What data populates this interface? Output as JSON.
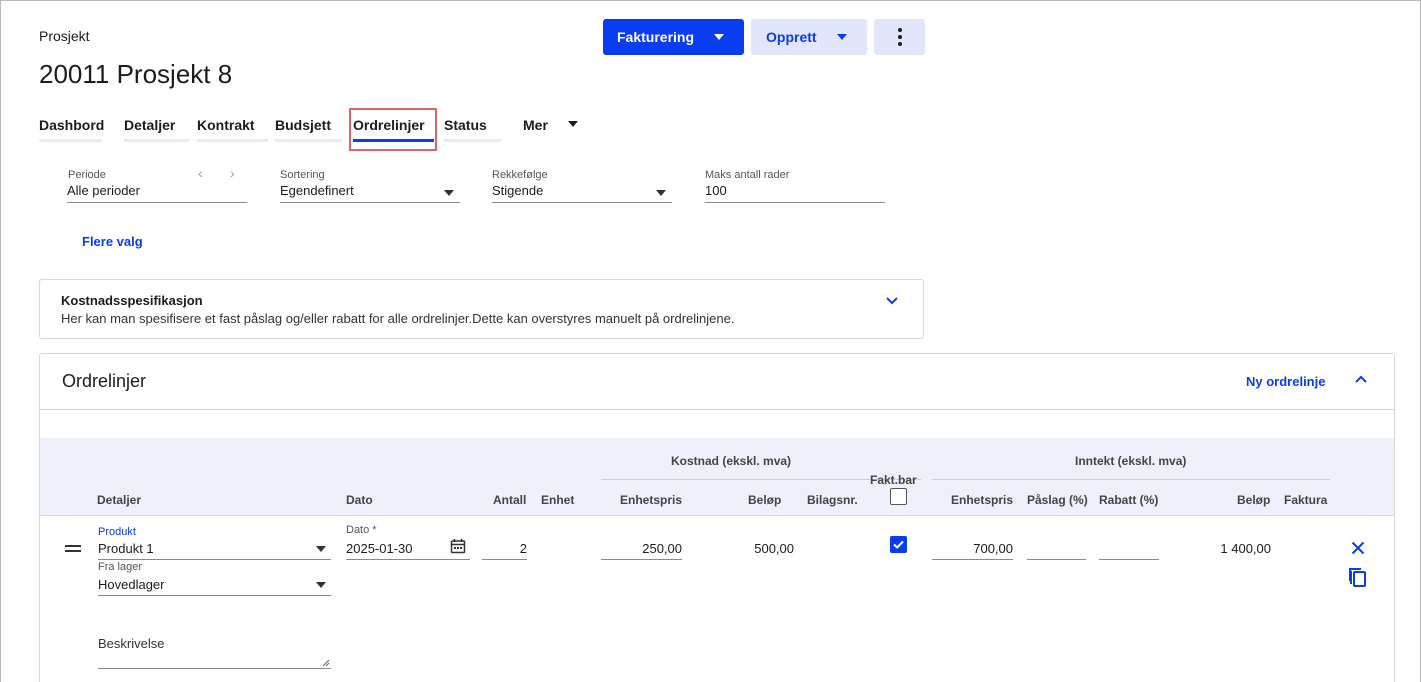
{
  "header": {
    "breadcrumb": "Prosjekt",
    "title": "20011 Prosjekt 8",
    "buttons": {
      "invoicing": "Fakturering",
      "create": "Opprett"
    }
  },
  "tabs": [
    {
      "label": "Dashbord"
    },
    {
      "label": "Detaljer"
    },
    {
      "label": "Kontrakt"
    },
    {
      "label": "Budsjett"
    },
    {
      "label": "Ordrelinjer",
      "active": true
    },
    {
      "label": "Status"
    },
    {
      "label": "Mer"
    }
  ],
  "filters": {
    "period": {
      "label": "Periode",
      "value": "Alle perioder"
    },
    "sorting": {
      "label": "Sortering",
      "value": "Egendefinert"
    },
    "order": {
      "label": "Rekkefølge",
      "value": "Stigende"
    },
    "max_rows": {
      "label": "Maks antall rader",
      "value": "100"
    },
    "more_options": "Flere valg"
  },
  "cost_spec": {
    "title": "Kostnadsspesifikasjon",
    "description": "Her kan man spesifisere et fast påslag og/eller rabatt for alle ordrelinjer.Dette kan overstyres manuelt på ordrelinjene."
  },
  "orders": {
    "title": "Ordrelinjer",
    "new_line": "Ny ordrelinje",
    "group_cost": "Kostnad (ekskl. mva)",
    "group_income": "Inntekt (ekskl. mva)",
    "columns": {
      "details": "Detaljer",
      "date": "Dato",
      "quantity": "Antall",
      "unit": "Enhet",
      "cost_unit_price": "Enhetspris",
      "cost_amount": "Beløp",
      "voucher_no": "Bilagsnr.",
      "billable": "Fakt.bar",
      "income_unit_price": "Enhetspris",
      "markup": "Påslag (%)",
      "discount": "Rabatt (%)",
      "income_amount": "Beløp",
      "invoice": "Faktura"
    },
    "row": {
      "product_label": "Produkt",
      "product_value": "Produkt 1",
      "warehouse_label": "Fra lager",
      "warehouse_value": "Hovedlager",
      "date_label": "Dato *",
      "date_value": "2025-01-30",
      "quantity": "2",
      "cost_unit_price": "250,00",
      "cost_amount": "500,00",
      "billable": true,
      "income_unit_price": "700,00",
      "income_amount": "1 400,00",
      "description_label": "Beskrivelse"
    }
  },
  "colors": {
    "accent": "#0a3cf0",
    "highlight": "#e06464",
    "header_band": "#eef1fb"
  }
}
